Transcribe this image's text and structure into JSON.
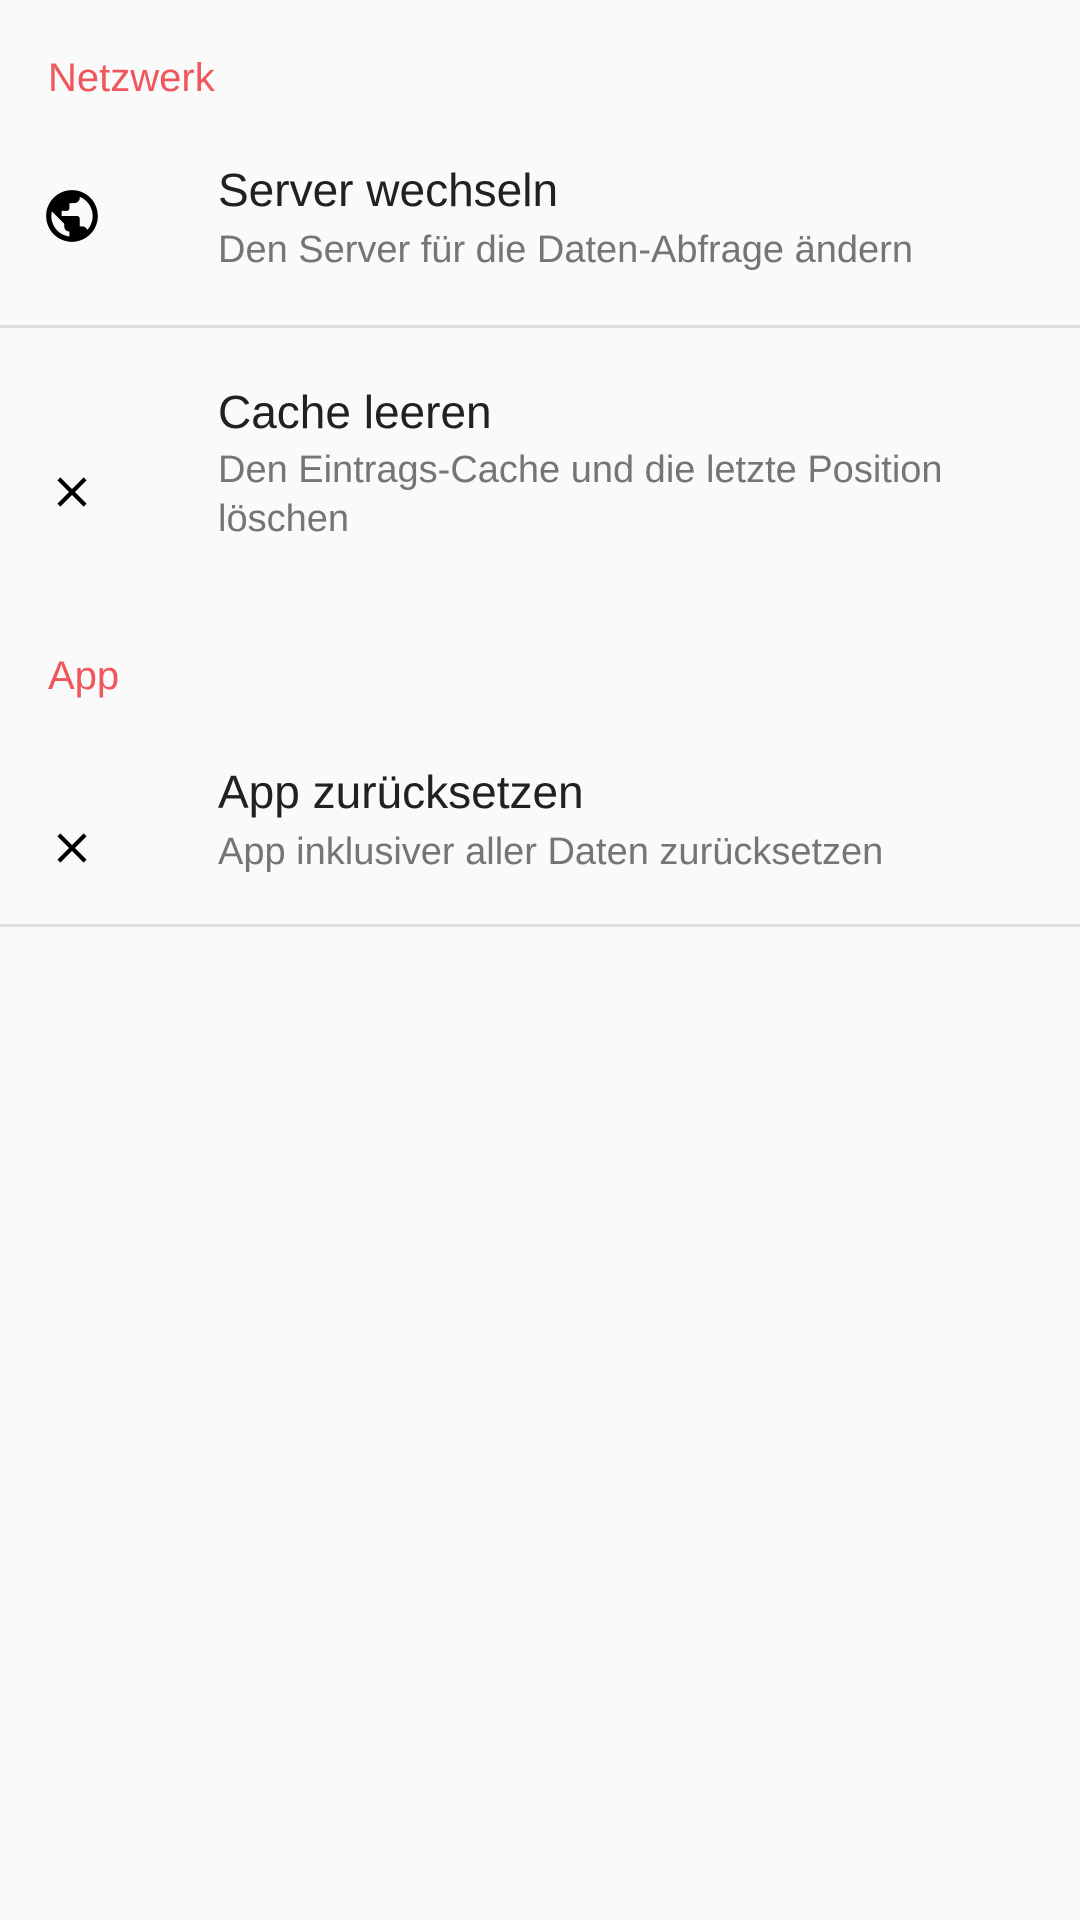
{
  "colors": {
    "accent": "#f0575c",
    "background": "#fafafa",
    "title_text": "#212121",
    "summary_text": "#757575",
    "divider": "#dedede"
  },
  "sections": {
    "network": {
      "header": "Netzwerk",
      "items": [
        {
          "icon": "globe-icon",
          "title": "Server wechseln",
          "summary": "Den Server für die Daten-Abfrage ändern"
        },
        {
          "icon": "close-icon",
          "title": "Cache leeren",
          "summary": "Den Eintrags-Cache und die letzte Position löschen"
        }
      ]
    },
    "app": {
      "header": "App",
      "items": [
        {
          "icon": "close-icon",
          "title": "App zurücksetzen",
          "summary": "App inklusiver aller Daten zurücksetzen"
        }
      ]
    }
  }
}
